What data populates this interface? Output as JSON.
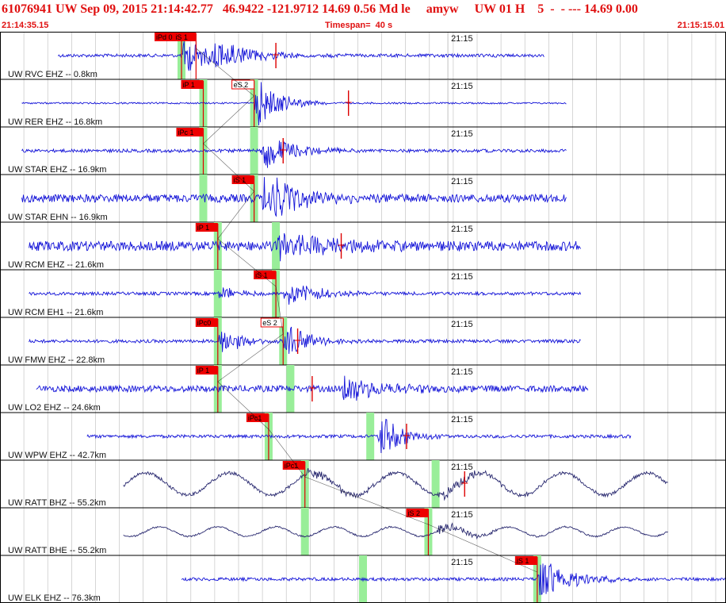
{
  "header": {
    "title": "61076941 UW Sep 09, 2015 21:14:42.77   46.9422 -121.9712 14.69 0.56 Md le     amyw     UW 01 H    5  -  - --- 14.69 0.00",
    "start_time": "21:14:35.15",
    "timespan": "Timespan=  40 s",
    "end_time": "21:15:15.01"
  },
  "colors": {
    "header_text": "#e01010",
    "trace_blue": "#1515d8",
    "trace_dark": "#2a2a70",
    "trace_red": "#dd0000",
    "pick_box": "#ee0000",
    "green_band": "#99ee99",
    "gridline": "#000000",
    "background": "#ffffff"
  },
  "chart_data": {
    "type": "line",
    "title": "",
    "x_unit": "seconds",
    "x_range": [
      0,
      40
    ],
    "minute_marker_label": "21:15",
    "minute_marker_time": 24.85,
    "channels": [
      {
        "label": "UW RVC EHZ -- 0.8km",
        "trace_span": [
          0.08,
          0.75
        ],
        "amp_noise": 2,
        "picks": [
          {
            "label": "iPd 0",
            "time": 0.25,
            "type": "P"
          },
          {
            "label": "iS 1",
            "time": 0.27,
            "type": "S"
          }
        ],
        "green_bands": [
          0.25
        ],
        "red_marks": [
          0.38
        ],
        "events": [
          {
            "time": 0.25,
            "amp": 22,
            "decay": 0.04,
            "freq": 2.0
          },
          {
            "time": 0.29,
            "amp": 18,
            "decay": 0.06,
            "freq": 1.6
          }
        ],
        "color": "blue"
      },
      {
        "label": "UW RER EHZ -- 16.8km",
        "trace_span": [
          0.03,
          0.78
        ],
        "amp_noise": 1,
        "picks": [
          {
            "label": "iP 1",
            "time": 0.28,
            "type": "P"
          },
          {
            "label": "eS 2",
            "time": 0.35,
            "type": "S-e"
          }
        ],
        "green_bands": [
          0.28,
          0.35
        ],
        "red_marks": [
          0.48
        ],
        "events": [
          {
            "time": 0.35,
            "amp": 26,
            "decay": 0.03,
            "freq": 2.5
          }
        ],
        "color": "blue"
      },
      {
        "label": "UW STAR EHZ -- 16.9km",
        "trace_span": [
          0.03,
          0.78
        ],
        "amp_noise": 2,
        "picks": [
          {
            "label": "iPc 1",
            "time": 0.28,
            "type": "P"
          }
        ],
        "green_bands": [
          0.28,
          0.35
        ],
        "red_marks": [
          0.39
        ],
        "events": [
          {
            "time": 0.36,
            "amp": 22,
            "decay": 0.04,
            "freq": 2.0
          }
        ],
        "color": "blue"
      },
      {
        "label": "UW STAR EHN -- 16.9km",
        "trace_span": [
          0.03,
          0.78
        ],
        "amp_noise": 5,
        "picks": [
          {
            "label": "iS 1",
            "time": 0.35,
            "type": "S"
          }
        ],
        "green_bands": [
          0.28,
          0.35
        ],
        "red_marks": [],
        "events": [
          {
            "time": 0.36,
            "amp": 28,
            "decay": 0.05,
            "freq": 2.0
          }
        ],
        "color": "blue"
      },
      {
        "label": "UW RCM EHZ -- 21.6km",
        "trace_span": [
          0.04,
          0.8
        ],
        "amp_noise": 6,
        "picks": [
          {
            "label": "iP 1",
            "time": 0.3,
            "type": "P"
          }
        ],
        "green_bands": [
          0.3,
          0.38
        ],
        "red_marks": [
          0.47
        ],
        "events": [
          {
            "time": 0.38,
            "amp": 20,
            "decay": 0.08,
            "freq": 1.5
          }
        ],
        "color": "blue"
      },
      {
        "label": "UW RCM EH1 -- 21.6km",
        "trace_span": [
          0.04,
          0.8
        ],
        "amp_noise": 2,
        "picks": [
          {
            "label": "iS 1",
            "time": 0.38,
            "type": "S"
          }
        ],
        "green_bands": [
          0.3,
          0.38
        ],
        "red_marks": [],
        "events": [
          {
            "time": 0.3,
            "amp": 8,
            "decay": 0.03,
            "freq": 2.0
          },
          {
            "time": 0.39,
            "amp": 26,
            "decay": 0.04,
            "freq": 1.3
          }
        ],
        "color": "blue"
      },
      {
        "label": "UW FMW EHZ -- 22.8km",
        "trace_span": [
          0.04,
          0.8
        ],
        "amp_noise": 2,
        "picks": [
          {
            "label": "iPc0",
            "time": 0.3,
            "type": "P"
          },
          {
            "label": "eS 2",
            "time": 0.39,
            "type": "S-e"
          }
        ],
        "green_bands": [
          0.3,
          0.39
        ],
        "red_marks": [
          0.41
        ],
        "events": [
          {
            "time": 0.3,
            "amp": 18,
            "decay": 0.03,
            "freq": 2.0
          },
          {
            "time": 0.39,
            "amp": 22,
            "decay": 0.03,
            "freq": 2.0
          }
        ],
        "color": "blue"
      },
      {
        "label": "UW LO2 EHZ -- 24.6km",
        "trace_span": [
          0.05,
          0.81
        ],
        "amp_noise": 4,
        "picks": [
          {
            "label": "iP 1",
            "time": 0.3,
            "type": "P"
          }
        ],
        "green_bands": [
          0.3,
          0.4
        ],
        "red_marks": [
          0.43
        ],
        "events": [
          {
            "time": 0.47,
            "amp": 26,
            "decay": 0.05,
            "freq": 1.4
          }
        ],
        "color": "blue"
      },
      {
        "label": "UW WPW EHZ -- 42.7km",
        "trace_span": [
          0.12,
          0.87
        ],
        "amp_noise": 2,
        "picks": [
          {
            "label": "iPc1",
            "time": 0.37,
            "type": "P"
          }
        ],
        "green_bands": [
          0.37,
          0.51
        ],
        "red_marks": [
          0.56
        ],
        "events": [
          {
            "time": 0.52,
            "amp": 26,
            "decay": 0.03,
            "freq": 2.0
          }
        ],
        "color": "blue"
      },
      {
        "label": "UW RATT BHZ -- 55.2km",
        "trace_span": [
          0.17,
          0.92
        ],
        "amp_noise": 2,
        "picks": [
          {
            "label": "iPc1",
            "time": 0.42,
            "type": "P"
          }
        ],
        "green_bands": [
          0.42,
          0.6
        ],
        "red_marks": [
          0.64
        ],
        "events": [
          {
            "time": 0.42,
            "amp": 14,
            "decay": 0.05,
            "freq": 1.0
          },
          {
            "time": 0.6,
            "amp": 14,
            "decay": 0.06,
            "freq": 1.0
          }
        ],
        "color": "dark",
        "long_period": {
          "amp": 14,
          "period": 0.115
        }
      },
      {
        "label": "UW RATT BHE -- 55.2km",
        "trace_span": [
          0.17,
          0.92
        ],
        "amp_noise": 1,
        "picks": [
          {
            "label": "iS 2",
            "time": 0.59,
            "type": "S"
          }
        ],
        "green_bands": [
          0.42,
          0.59
        ],
        "red_marks": [],
        "events": [
          {
            "time": 0.6,
            "amp": 12,
            "decay": 0.05,
            "freq": 1.0
          }
        ],
        "color": "dark",
        "long_period": {
          "amp": 6,
          "period": 0.08
        }
      },
      {
        "label": "UW ELK EHZ -- 76.3km",
        "trace_span": [
          0.25,
          1.0
        ],
        "amp_noise": 2,
        "picks": [
          {
            "label": "iS 1",
            "time": 0.74,
            "type": "S"
          }
        ],
        "green_bands": [
          0.5,
          0.74
        ],
        "red_marks": [],
        "events": [
          {
            "time": 0.74,
            "amp": 28,
            "decay": 0.04,
            "freq": 1.8
          }
        ],
        "color": "blue"
      }
    ]
  }
}
